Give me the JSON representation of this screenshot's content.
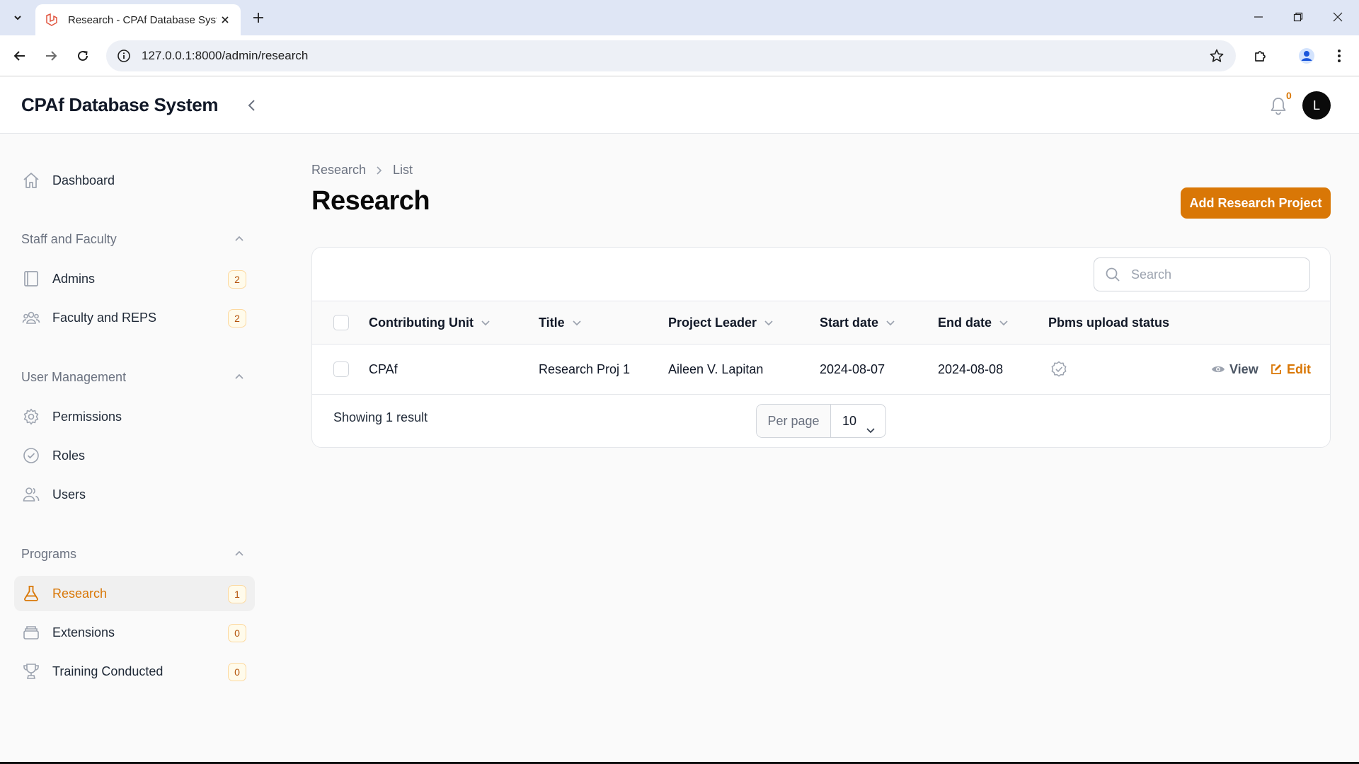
{
  "browser": {
    "tab_title": "Research - CPAf Database System",
    "url": "127.0.0.1:8000/admin/research"
  },
  "header": {
    "brand": "CPAf Database System",
    "notification_count": "0",
    "avatar_initial": "L"
  },
  "sidebar": {
    "dashboard": "Dashboard",
    "groups": [
      {
        "label": "Staff and Faculty",
        "items": [
          {
            "label": "Admins",
            "badge": "2"
          },
          {
            "label": "Faculty and REPS",
            "badge": "2"
          }
        ]
      },
      {
        "label": "User Management",
        "items": [
          {
            "label": "Permissions"
          },
          {
            "label": "Roles"
          },
          {
            "label": "Users"
          }
        ]
      },
      {
        "label": "Programs",
        "items": [
          {
            "label": "Research",
            "badge": "1",
            "active": true
          },
          {
            "label": "Extensions",
            "badge": "0"
          },
          {
            "label": "Training Conducted",
            "badge": "0"
          }
        ]
      }
    ]
  },
  "main": {
    "breadcrumb": [
      "Research",
      "List"
    ],
    "title": "Research",
    "add_button": "Add Research Project",
    "search_placeholder": "Search",
    "columns": [
      "Contributing Unit",
      "Title",
      "Project Leader",
      "Start date",
      "End date",
      "Pbms upload status"
    ],
    "rows": [
      {
        "unit": "CPAf",
        "title": "Research Proj 1",
        "leader": "Aileen V. Lapitan",
        "start": "2024-08-07",
        "end": "2024-08-08",
        "view": "View",
        "edit": "Edit"
      }
    ],
    "footer_text": "Showing 1 result",
    "per_page_label": "Per page",
    "per_page_value": "10"
  },
  "colors": {
    "accent": "#d97706",
    "text": "#111827",
    "muted": "#6b7280"
  }
}
